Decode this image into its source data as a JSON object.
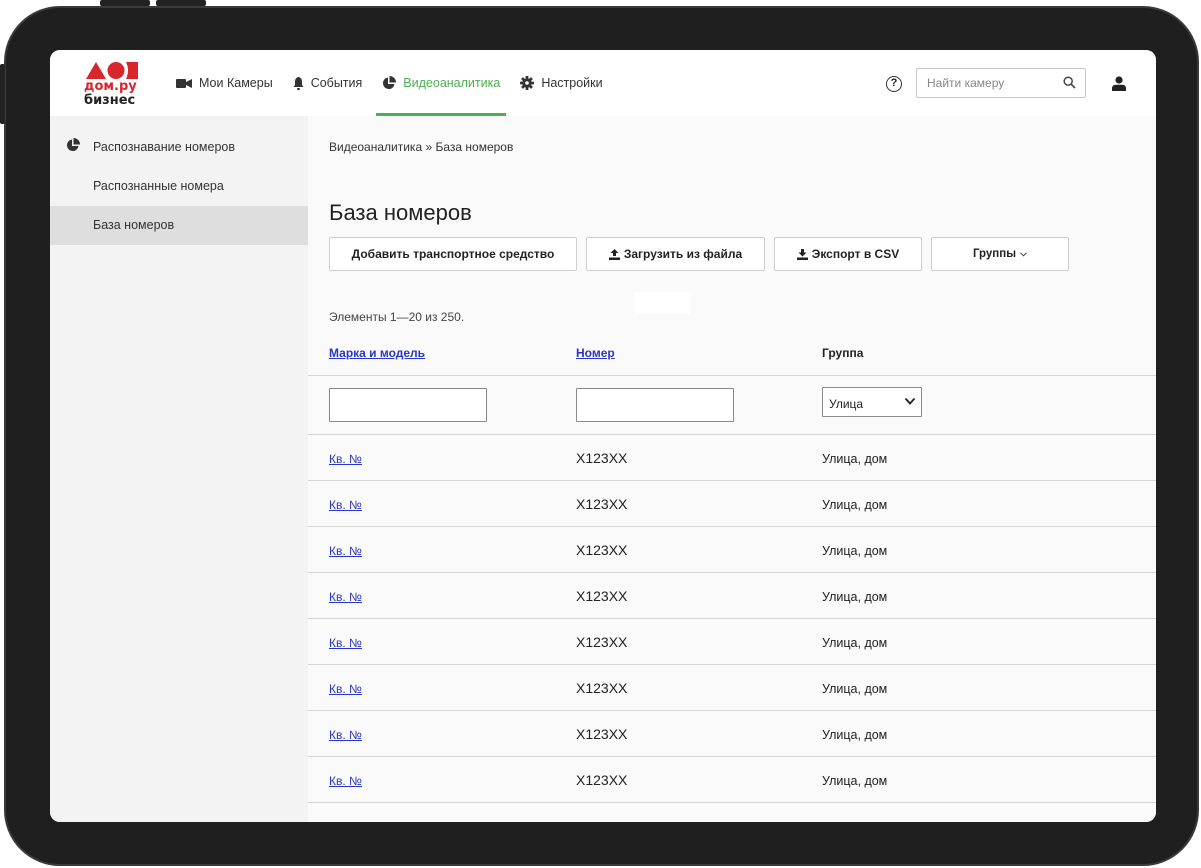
{
  "header": {
    "logo": {
      "line1": "дом.ру",
      "line2": "бизнес"
    },
    "nav": [
      {
        "label": "Мои Камеры",
        "icon": "video-camera-icon",
        "active": false
      },
      {
        "label": "События",
        "icon": "bell-icon",
        "active": false
      },
      {
        "label": "Видеоаналитика",
        "icon": "pie-chart-icon",
        "active": true
      },
      {
        "label": "Настройки",
        "icon": "gear-icon",
        "active": false
      }
    ],
    "help_icon_text": "?",
    "search": {
      "placeholder": "Найти камеру",
      "value": ""
    }
  },
  "sidebar": {
    "items": [
      {
        "label": "Распознавание номеров",
        "active": false
      },
      {
        "label": "Распознанные номера",
        "active": false
      },
      {
        "label": "База номеров",
        "active": true
      }
    ]
  },
  "main": {
    "breadcrumb": "Видеоаналитика » База номеров",
    "title": "База номеров",
    "buttons": {
      "add": "Добавить транспортное средство",
      "upload": "Загрузить из файла",
      "export": "Экспорт в CSV",
      "groups": "Группы"
    },
    "count": "Элементы 1—20 из 250.",
    "columns": [
      "Марка и модель",
      "Номер",
      "Группа"
    ],
    "filters": {
      "model": "",
      "number": "",
      "group": "Улица"
    },
    "rows": [
      {
        "model": "Кв. №",
        "number": "X123XX",
        "group": "Улица, дом"
      },
      {
        "model": "Кв. №",
        "number": "X123XX",
        "group": "Улица, дом"
      },
      {
        "model": "Кв. №",
        "number": "X123XX",
        "group": "Улица, дом"
      },
      {
        "model": "Кв. №",
        "number": "X123XX",
        "group": "Улица, дом"
      },
      {
        "model": "Кв. №",
        "number": "X123XX",
        "group": "Улица, дом"
      },
      {
        "model": "Кв. №",
        "number": "X123XX",
        "group": "Улица, дом"
      },
      {
        "model": "Кв. №",
        "number": "X123XX",
        "group": "Улица, дом"
      },
      {
        "model": "Кв. №",
        "number": "X123XX",
        "group": "Улица, дом"
      }
    ]
  },
  "colors": {
    "brand_red": "#d8262d",
    "accent_green": "#4caf50",
    "link_blue": "#2a35c9",
    "frame": "#1f1f1f",
    "sidebar_bg": "#f3f3f3",
    "sidebar_active": "#dedede",
    "main_bg": "#fafafa"
  }
}
